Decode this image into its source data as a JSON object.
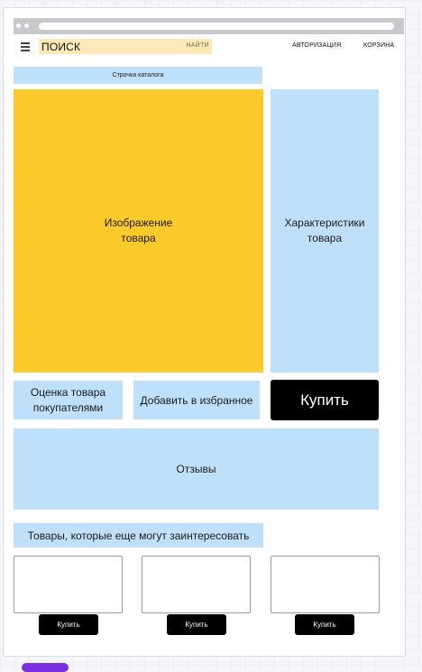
{
  "header": {
    "search_placeholder": "ПОИСК",
    "search_button": "НАЙТИ",
    "login": "АВТОРИЗАЦИЯ",
    "cart": "КОРЗИНА"
  },
  "catalog_line": "Строчка каталога",
  "product": {
    "image_label": "Изображение\nтовара",
    "specs_label": "Характеристики\nтовара",
    "rating_label": "Оценка товара\nпокупателями",
    "favorite_label": "Добавить в избранное",
    "buy_label": "Купить",
    "reviews_label": "Отзывы"
  },
  "recommendations": {
    "title": "Товары, которые еще могут заинтересовать",
    "items": [
      {
        "buy_label": "Купить"
      },
      {
        "buy_label": "Купить"
      },
      {
        "buy_label": "Купить"
      }
    ]
  },
  "colors": {
    "accent_yellow": "#fdca2c",
    "panel_blue": "#bfe0fb",
    "search_bg": "#fde9b7",
    "button_black": "#000000"
  }
}
